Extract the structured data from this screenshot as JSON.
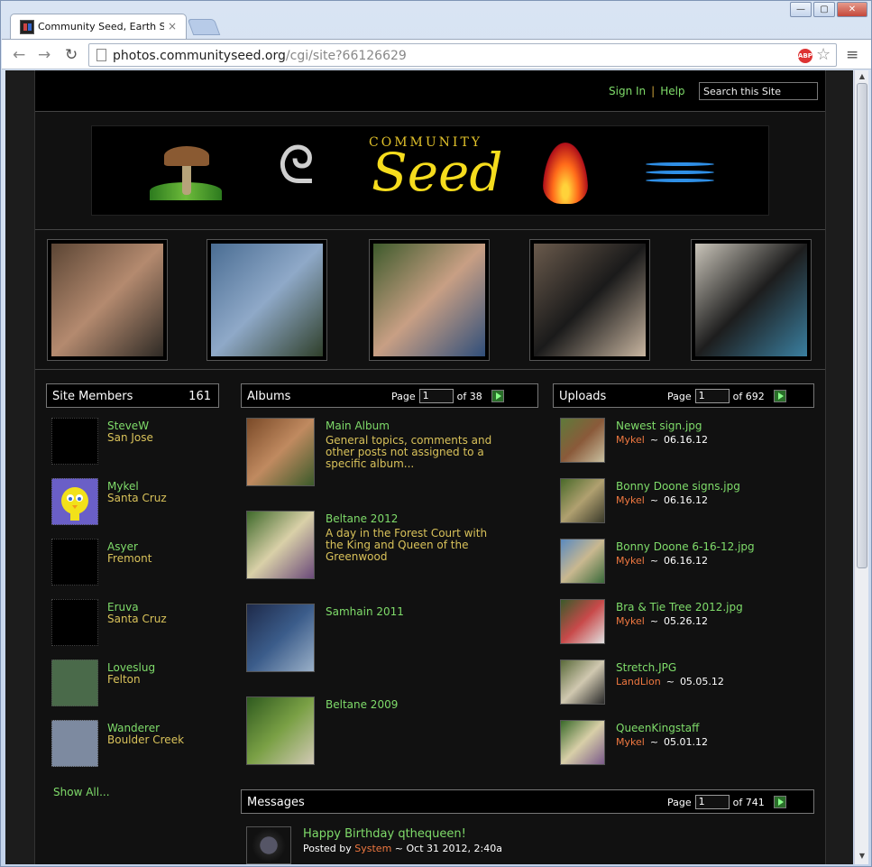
{
  "browser": {
    "tab_title": "Community Seed, Earth Spirit",
    "tab_close": "×",
    "url_host": "photos.communityseed.org",
    "url_path": "/cgi/site?66126629",
    "window_min": "—",
    "window_max": "▢",
    "window_close": "✕",
    "back_glyph": "←",
    "forward_glyph": "→",
    "reload_glyph": "↻",
    "star_glyph": "☆",
    "menu_glyph": "≡",
    "abp_label": "ABP"
  },
  "header": {
    "sign_in": "Sign In",
    "separator": "|",
    "help": "Help",
    "search_placeholder": "Search this Site"
  },
  "banner": {
    "community": "COMMUNITY",
    "seed": "Seed",
    "triskele_glyph": "ᘓ"
  },
  "featured_photos": [
    {
      "name": "hands-with-sprout",
      "colors": [
        "#5b4534",
        "#b48a6f",
        "#2e2a25"
      ]
    },
    {
      "name": "mountain-view",
      "colors": [
        "#4a6d93",
        "#8fa9c8",
        "#2f3f2a"
      ]
    },
    {
      "name": "smiling-man",
      "colors": [
        "#3d5a2b",
        "#c89f84",
        "#2f4e7a"
      ]
    },
    {
      "name": "pirate-hat-man",
      "colors": [
        "#6a5a4c",
        "#1a1a1a",
        "#c8b5a0"
      ]
    },
    {
      "name": "dancing-couple",
      "colors": [
        "#c9c4b9",
        "#1d1d1d",
        "#3a7fa0"
      ]
    }
  ],
  "members": {
    "title": "Site Members",
    "count": "161",
    "items": [
      {
        "name": "SteveW",
        "location": "San Jose",
        "color": "#000000"
      },
      {
        "name": "Mykel",
        "location": "Santa Cruz",
        "color": "#6a5fc7"
      },
      {
        "name": "Asyer",
        "location": "Fremont",
        "color": "#000000"
      },
      {
        "name": "Eruva",
        "location": "Santa Cruz",
        "color": "#000000"
      },
      {
        "name": "Loveslug",
        "location": "Felton",
        "color": "#4a6a4a"
      },
      {
        "name": "Wanderer",
        "location": "Boulder Creek",
        "color": "#7d8aa0"
      }
    ],
    "show_all": "Show All..."
  },
  "albums": {
    "title": "Albums",
    "page_label": "Page",
    "page_value": "1",
    "of_label": "of 38",
    "items": [
      {
        "title": "Main Album",
        "description": "General topics, comments and other posts not assigned to a specific album...",
        "colors": [
          "#7a4a28",
          "#c08a60",
          "#3b5a2a"
        ]
      },
      {
        "title": "Beltane 2012",
        "description": "A day in the Forest Court with the King and Queen of the Greenwood",
        "colors": [
          "#3f6a2b",
          "#d9d0a8",
          "#6b4a7a"
        ]
      },
      {
        "title": "Samhain 2011",
        "description": "",
        "colors": [
          "#1e2a4a",
          "#3b5c8a",
          "#9ab0c8"
        ]
      },
      {
        "title": "Beltane 2009",
        "description": "",
        "colors": [
          "#2f5a1f",
          "#7aa045",
          "#d2c9b5"
        ]
      }
    ]
  },
  "uploads": {
    "title": "Uploads",
    "page_label": "Page",
    "page_value": "1",
    "of_label": "of 692",
    "items": [
      {
        "title": "Newest sign.jpg",
        "user": "Mykel",
        "date": "06.16.12",
        "colors": [
          "#5f7a3a",
          "#8a5a3a",
          "#c9c0a0"
        ]
      },
      {
        "title": "Bonny Doone signs.jpg",
        "user": "Mykel",
        "date": "06.16.12",
        "colors": [
          "#4a6a2a",
          "#b0a070",
          "#3a3a2a"
        ]
      },
      {
        "title": "Bonny Doone 6-16-12.jpg",
        "user": "Mykel",
        "date": "06.16.12",
        "colors": [
          "#5a8ac0",
          "#c9b890",
          "#3a6a3a"
        ]
      },
      {
        "title": "Bra & Tie Tree 2012.jpg",
        "user": "Mykel",
        "date": "05.26.12",
        "colors": [
          "#3a5a2a",
          "#c84a4a",
          "#e0e0e0"
        ]
      },
      {
        "title": "Stretch.JPG",
        "user": "LandLion",
        "date": "05.05.12",
        "colors": [
          "#5a6a3a",
          "#d0c8b0",
          "#2a2a2a"
        ]
      },
      {
        "title": "QueenKingstaff",
        "user": "Mykel",
        "date": "05.01.12",
        "colors": [
          "#3a6a2a",
          "#d8cfa8",
          "#7a5a8a"
        ]
      }
    ]
  },
  "messages": {
    "title": "Messages",
    "page_label": "Page",
    "page_value": "1",
    "of_label": "of 741",
    "first_title": "Happy Birthday qthequeen!",
    "posted_by": "Posted by",
    "author": "System",
    "tilde": "~",
    "date": "Oct 31 2012, 2:40a"
  },
  "tilde": "~"
}
